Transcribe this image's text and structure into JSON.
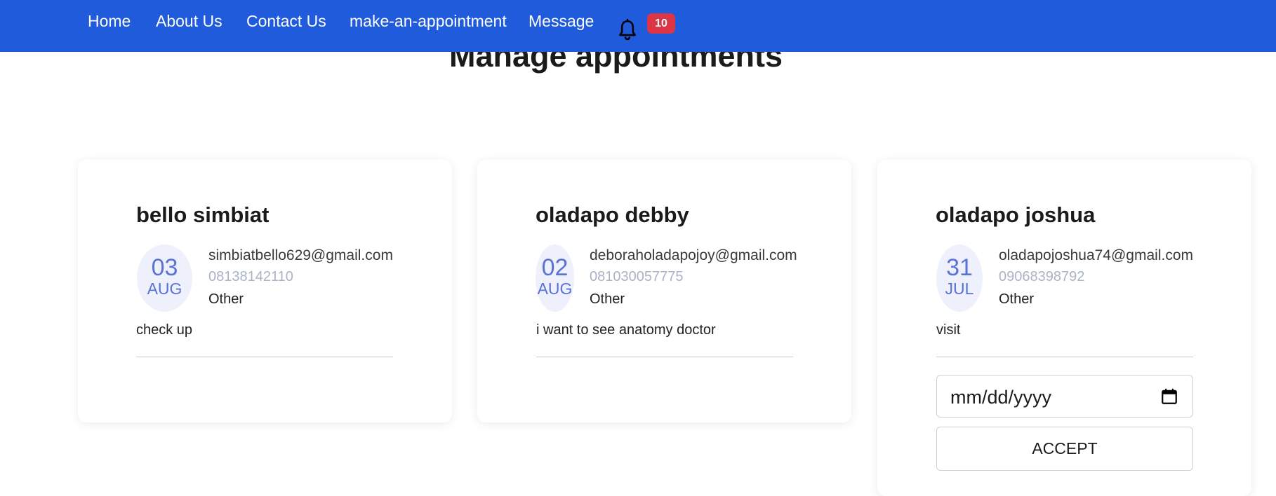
{
  "nav": {
    "links": [
      "Home",
      "About Us",
      "Contact Us",
      "make-an-appointment",
      "Message"
    ],
    "notification_count": "10",
    "bg_color": "#1f5bdb"
  },
  "page": {
    "title": "Manage appointments"
  },
  "appointments": [
    {
      "name": "bello simbiat",
      "day": "03",
      "month": "AUG",
      "email": "simbiatbello629@gmail.com",
      "phone": "08138142110",
      "category": "Other",
      "reason": "check up"
    },
    {
      "name": "oladapo debby",
      "day": "02",
      "month": "AUG",
      "email": "deboraholadapojoy@gmail.com",
      "phone": "081030057775",
      "category": "Other",
      "reason": "i want to see anatomy doctor"
    },
    {
      "name": "oladapo joshua",
      "day": "31",
      "month": "JUL",
      "email": "oladapojoshua74@gmail.com",
      "phone": "09068398792",
      "category": "Other",
      "reason": "visit"
    }
  ],
  "accept_form": {
    "date_placeholder": "mm/dd/yyyy",
    "accept_label": "ACCEPT"
  }
}
